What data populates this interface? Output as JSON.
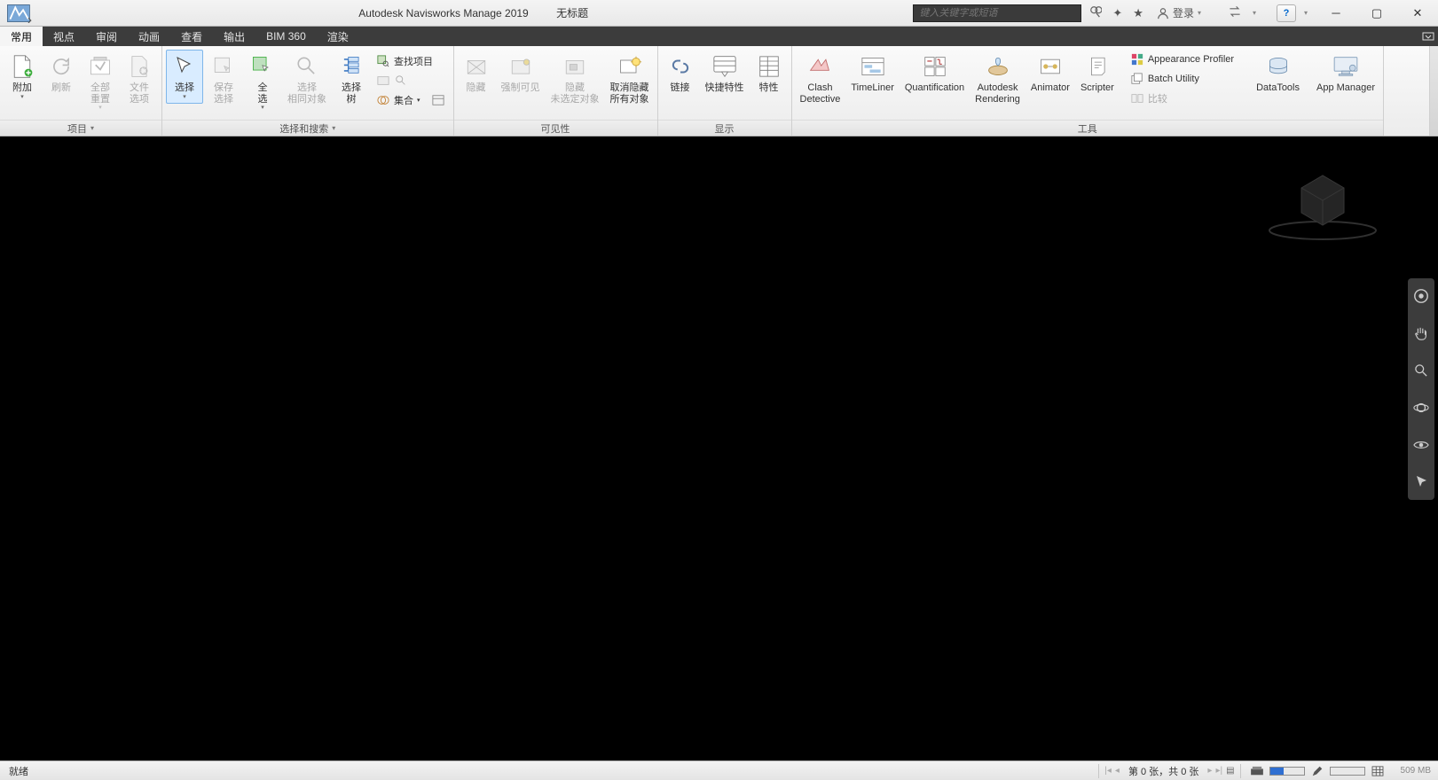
{
  "title": {
    "app": "Autodesk Navisworks Manage 2019",
    "doc": "无标题"
  },
  "search_placeholder": "键入关键字或短语",
  "login_label": "登录",
  "tabs": [
    "常用",
    "视点",
    "审阅",
    "动画",
    "查看",
    "输出",
    "BIM 360",
    "渲染"
  ],
  "active_tab_index": 0,
  "panels": {
    "project": {
      "title": "项目",
      "items": {
        "attach": "附加",
        "refresh": "刷新",
        "resetall": "全部\n重置",
        "fileopts": "文件\n选项"
      }
    },
    "select": {
      "title": "选择和搜索",
      "items": {
        "select": "选择",
        "savesel": "保存\n选择",
        "all": "全\n选",
        "same": "选择\n相同对象",
        "tree": "选择\n树",
        "find": "查找项目",
        "sets": "集合"
      }
    },
    "visibility": {
      "title": "可见性",
      "items": {
        "hide": "隐藏",
        "require": "强制可见",
        "hideunsel": "隐藏\n未选定对象",
        "unhide": "取消隐藏\n所有对象"
      }
    },
    "display": {
      "title": "显示",
      "items": {
        "links": "链接",
        "qprops": "快捷特性",
        "props": "特性"
      }
    },
    "tools": {
      "title": "工具",
      "items": {
        "clash": "Clash\nDetective",
        "timeliner": "TimeLiner",
        "quant": "Quantification",
        "render": "Autodesk\nRendering",
        "animator": "Animator",
        "scripter": "Scripter",
        "appprof": "Appearance Profiler",
        "batch": "Batch Utility",
        "compare": "比较",
        "datatools": "DataTools",
        "appmgr": "App Manager"
      }
    }
  },
  "status": {
    "ready": "就绪",
    "pager": "第 0 张，共 0 张",
    "mem": "509 MB"
  }
}
